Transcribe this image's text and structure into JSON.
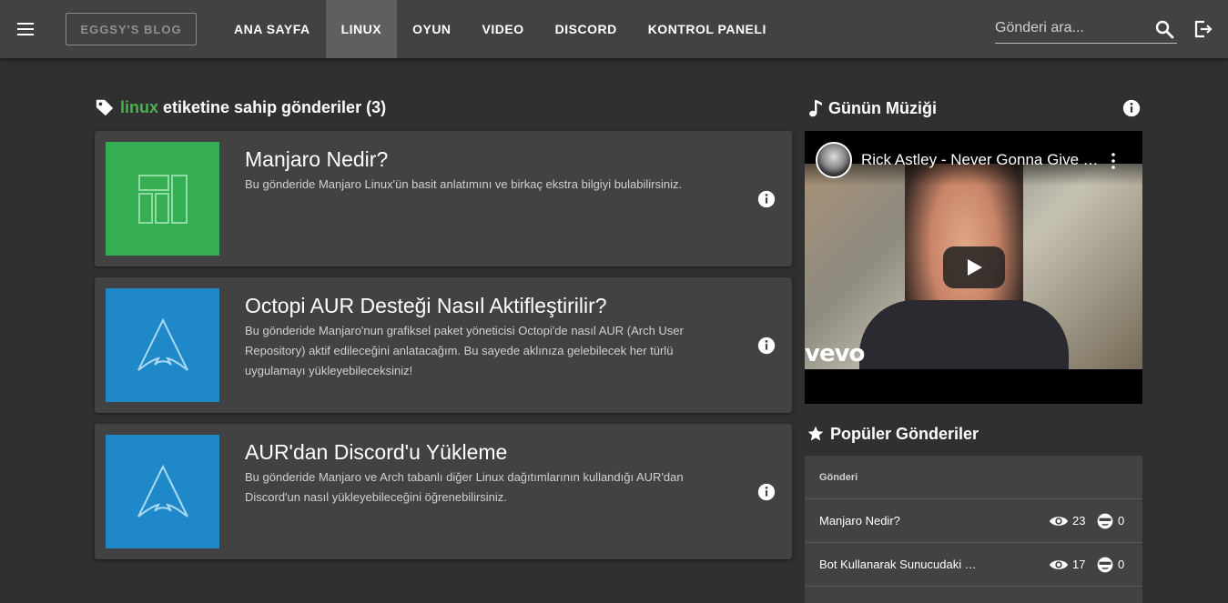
{
  "header": {
    "brand": "EGGSY'S BLOG",
    "nav": [
      {
        "label": "ANA SAYFA",
        "active": false
      },
      {
        "label": "LINUX",
        "active": true
      },
      {
        "label": "OYUN",
        "active": false
      },
      {
        "label": "VIDEO",
        "active": false
      },
      {
        "label": "DISCORD",
        "active": false
      },
      {
        "label": "KONTROL PANELI",
        "active": false
      }
    ],
    "search_placeholder": "Gönderi ara..."
  },
  "main": {
    "tag": "linux",
    "title_suffix": "etiketine sahip gönderiler (3)",
    "posts": [
      {
        "title": "Manjaro Nedir?",
        "desc": "Bu gönderide Manjaro Linux'ün basit anlatımını ve birkaç ekstra bilgiyi bulabilirsiniz.",
        "thumb": "manjaro-logo"
      },
      {
        "title": "Octopi AUR Desteği Nasıl Aktifleştirilir?",
        "desc": "Bu gönderide Manjaro'nun grafiksel paket yöneticisi Octopi'de nasıl AUR (Arch User Repository) aktif edileceğini anlatacağım. Bu sayede aklınıza gelebilecek her türlü uygulamayı yükleyebileceksiniz!",
        "thumb": "arch-logo"
      },
      {
        "title": "AUR'dan Discord'u Yükleme",
        "desc": "Bu gönderide Manjaro ve Arch tabanlı diğer Linux dağıtımlarının kullandığı AUR'dan Discord'un nasıl yükleyebileceğini öğrenebilirsiniz.",
        "thumb": "arch-logo"
      }
    ]
  },
  "sidebar": {
    "music_title": "Günün Müziği",
    "video_title": "Rick Astley - Never Gonna Give You Up",
    "video_watermark": "vevo",
    "popular_title": "Popüler Gönderiler",
    "table_header": "Gönderi",
    "rows": [
      {
        "name": "Manjaro Nedir?",
        "views": "23",
        "likes": "0"
      },
      {
        "name": "Bot Kullanarak Sunucudaki Rolleri Yönetme",
        "views": "17",
        "likes": "0"
      }
    ]
  },
  "colors": {
    "accent_tag": "#4caf50",
    "header_bg": "#424242",
    "page_bg": "#303030",
    "manjaro_green": "#35ad52",
    "arch_blue": "#1f88c9"
  }
}
